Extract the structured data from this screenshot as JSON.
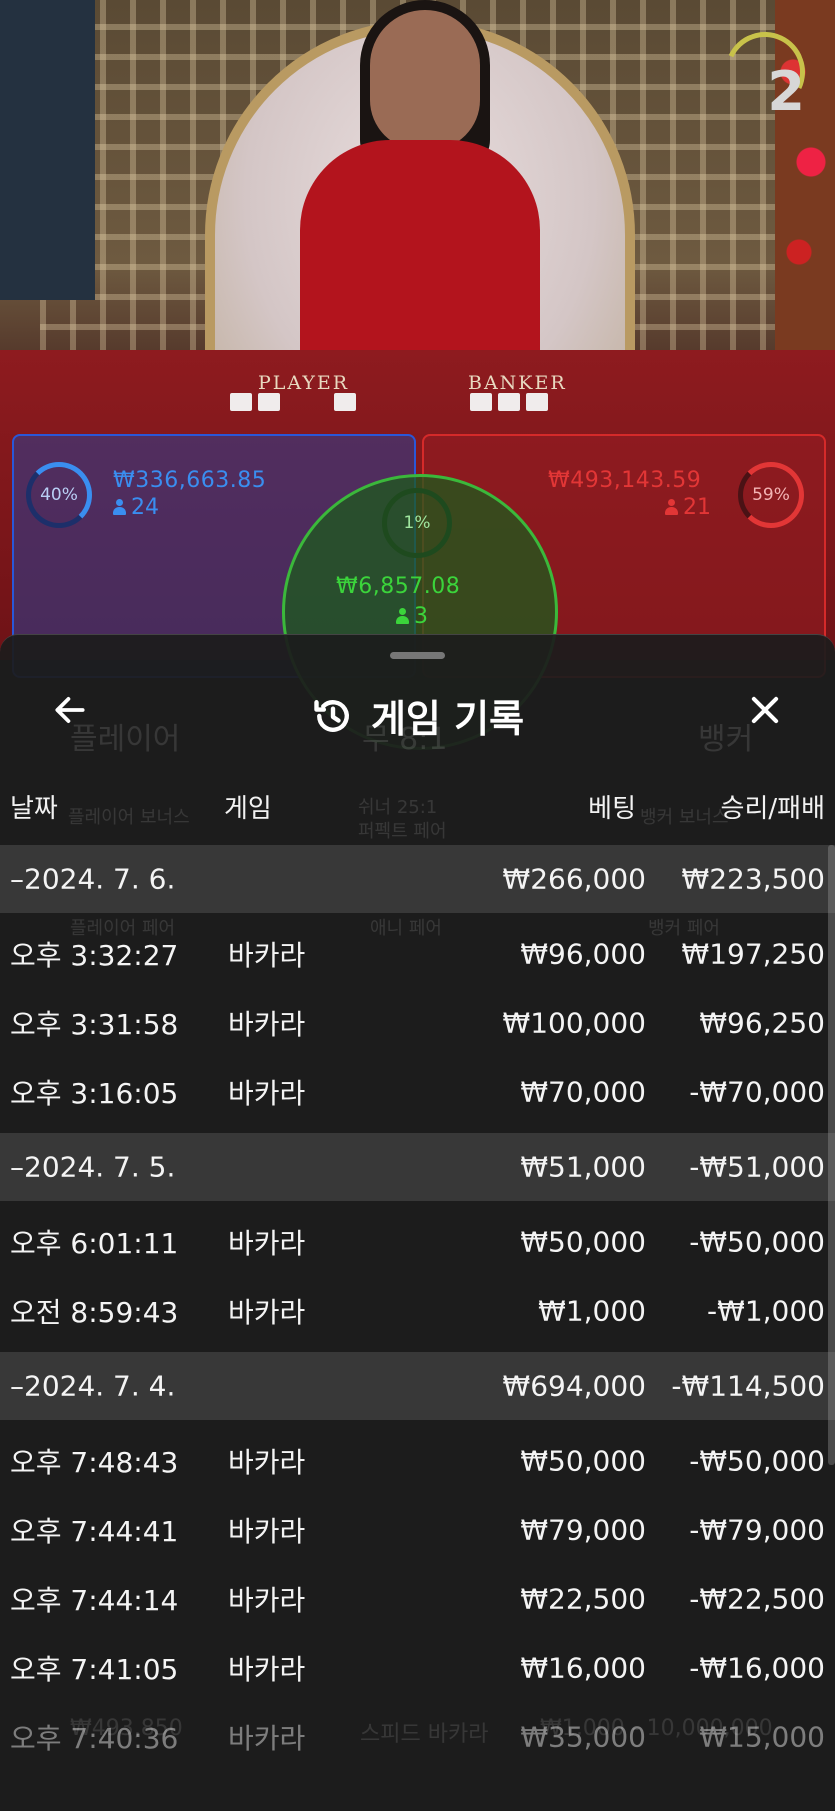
{
  "scene": {
    "round_number": "2",
    "table_labels": [
      "PLAYER",
      "BANKER"
    ]
  },
  "bets": {
    "player": {
      "percent": "40%",
      "amount": "₩336,663.85",
      "count": "24",
      "color": "#3a8ef0"
    },
    "banker": {
      "percent": "59%",
      "amount": "₩493,143.59",
      "count": "21",
      "color": "#e23636"
    },
    "tie": {
      "percent": "1%",
      "amount": "₩6,857.08",
      "count": "3",
      "color": "#3bd43b"
    }
  },
  "ghost_text": {
    "player": "플레이어",
    "tie": "무 8:1",
    "banker": "뱅커",
    "player_bonus": "플레이어 보너스",
    "either_pair": "쉬너 25:1",
    "perfect_pair": "퍼펙트 페어",
    "banker_bonus": "뱅커 보너스",
    "player_pair": "플레이어 페어",
    "any_pair": "애니 페어",
    "banker_pair": "뱅커 페어",
    "speed_baccarat": "스피드 바카라",
    "limits": "₩1,000 - 10,000,000",
    "balance": "₩493,850"
  },
  "sheet": {
    "title": "게임 기록",
    "columns": {
      "date": "날짜",
      "game": "게임",
      "bet": "베팅",
      "result": "승리/패배"
    },
    "rows": [
      {
        "kind": "date",
        "date": "–2024. 7. 6.",
        "game": "",
        "bet": "₩266,000",
        "result": "₩223,500"
      },
      {
        "kind": "item",
        "date": "오후 3:32:27",
        "game": "바카라",
        "bet": "₩96,000",
        "result": "₩197,250"
      },
      {
        "kind": "item",
        "date": "오후 3:31:58",
        "game": "바카라",
        "bet": "₩100,000",
        "result": "₩96,250"
      },
      {
        "kind": "item",
        "date": "오후 3:16:05",
        "game": "바카라",
        "bet": "₩70,000",
        "result": "-₩70,000"
      },
      {
        "kind": "date",
        "date": "–2024. 7. 5.",
        "game": "",
        "bet": "₩51,000",
        "result": "-₩51,000"
      },
      {
        "kind": "item",
        "date": "오후 6:01:11",
        "game": "바카라",
        "bet": "₩50,000",
        "result": "-₩50,000"
      },
      {
        "kind": "item",
        "date": "오전 8:59:43",
        "game": "바카라",
        "bet": "₩1,000",
        "result": "-₩1,000"
      },
      {
        "kind": "date",
        "date": "–2024. 7. 4.",
        "game": "",
        "bet": "₩694,000",
        "result": "-₩114,500"
      },
      {
        "kind": "item",
        "date": "오후 7:48:43",
        "game": "바카라",
        "bet": "₩50,000",
        "result": "-₩50,000"
      },
      {
        "kind": "item",
        "date": "오후 7:44:41",
        "game": "바카라",
        "bet": "₩79,000",
        "result": "-₩79,000"
      },
      {
        "kind": "item",
        "date": "오후 7:44:14",
        "game": "바카라",
        "bet": "₩22,500",
        "result": "-₩22,500"
      },
      {
        "kind": "item",
        "date": "오후 7:41:05",
        "game": "바카라",
        "bet": "₩16,000",
        "result": "-₩16,000"
      },
      {
        "kind": "item",
        "date": "오후 7:40:36",
        "game": "바카라",
        "bet": "₩35,000",
        "result": "₩15,000"
      }
    ]
  }
}
